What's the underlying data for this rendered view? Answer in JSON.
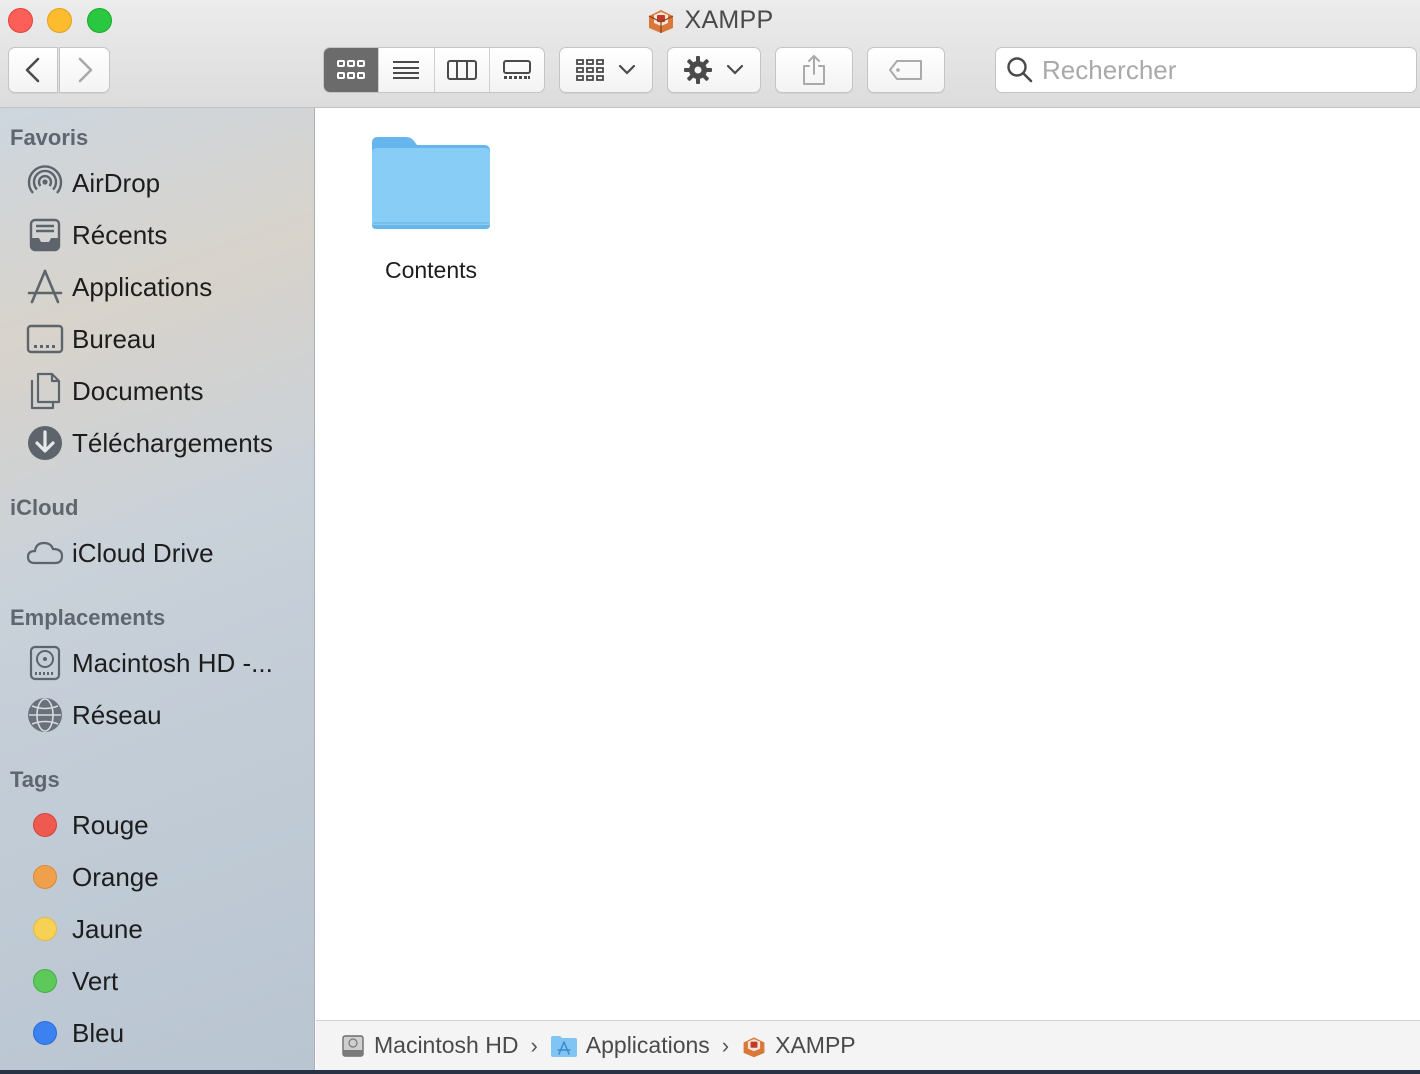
{
  "window": {
    "title": "XAMPP"
  },
  "toolbar": {
    "search_placeholder": "Rechercher",
    "view_mode": "icon"
  },
  "sidebar": {
    "sections": {
      "favorites": "Favoris",
      "icloud": "iCloud",
      "locations": "Emplacements",
      "tags": "Tags"
    },
    "favorites": [
      {
        "label": "AirDrop",
        "icon": "airdrop-icon"
      },
      {
        "label": "Récents",
        "icon": "recents-icon"
      },
      {
        "label": "Applications",
        "icon": "applications-icon"
      },
      {
        "label": "Bureau",
        "icon": "desktop-icon"
      },
      {
        "label": "Documents",
        "icon": "documents-icon"
      },
      {
        "label": "Téléchargements",
        "icon": "downloads-icon"
      }
    ],
    "icloud": [
      {
        "label": "iCloud Drive",
        "icon": "cloud-icon"
      }
    ],
    "locations": [
      {
        "label": "Macintosh HD -...",
        "icon": "hard-drive-icon"
      },
      {
        "label": "Réseau",
        "icon": "network-icon"
      }
    ],
    "tags": [
      {
        "label": "Rouge",
        "color": "#ee5a4f"
      },
      {
        "label": "Orange",
        "color": "#f0a04b"
      },
      {
        "label": "Jaune",
        "color": "#f7d155"
      },
      {
        "label": "Vert",
        "color": "#5cc95a"
      },
      {
        "label": "Bleu",
        "color": "#3b82f0"
      }
    ]
  },
  "content": {
    "items": [
      {
        "name": "Contents",
        "type": "folder"
      }
    ]
  },
  "pathbar": {
    "crumbs": [
      "Macintosh HD",
      "Applications",
      "XAMPP"
    ]
  },
  "colors": {
    "folder": "#7cc6f3",
    "accent": "#3b82f0"
  }
}
